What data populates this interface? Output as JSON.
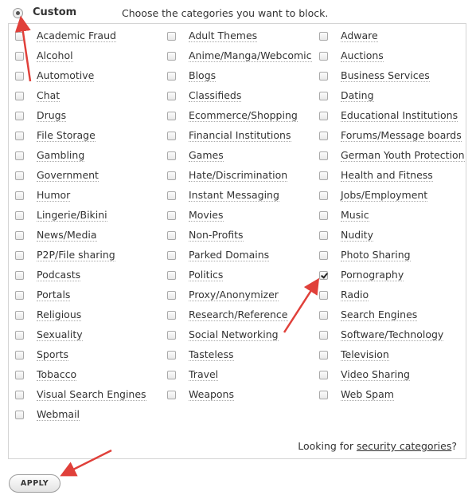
{
  "filter_mode": {
    "label": "Custom",
    "selected": true
  },
  "instructions": "Choose the categories you want to block.",
  "categories": [
    {
      "label": "Academic Fraud",
      "checked": false
    },
    {
      "label": "Alcohol",
      "checked": false
    },
    {
      "label": "Automotive",
      "checked": false
    },
    {
      "label": "Chat",
      "checked": false
    },
    {
      "label": "Drugs",
      "checked": false
    },
    {
      "label": "File Storage",
      "checked": false
    },
    {
      "label": "Gambling",
      "checked": false
    },
    {
      "label": "Government",
      "checked": false
    },
    {
      "label": "Humor",
      "checked": false
    },
    {
      "label": "Lingerie/Bikini",
      "checked": false
    },
    {
      "label": "News/Media",
      "checked": false
    },
    {
      "label": "P2P/File sharing",
      "checked": false
    },
    {
      "label": "Podcasts",
      "checked": false
    },
    {
      "label": "Portals",
      "checked": false
    },
    {
      "label": "Religious",
      "checked": false
    },
    {
      "label": "Sexuality",
      "checked": false
    },
    {
      "label": "Sports",
      "checked": false
    },
    {
      "label": "Tobacco",
      "checked": false
    },
    {
      "label": "Visual Search Engines",
      "checked": false
    },
    {
      "label": "Webmail",
      "checked": false
    },
    {
      "label": "Adult Themes",
      "checked": false
    },
    {
      "label": "Anime/Manga/Webcomic",
      "checked": false
    },
    {
      "label": "Blogs",
      "checked": false
    },
    {
      "label": "Classifieds",
      "checked": false
    },
    {
      "label": "Ecommerce/Shopping",
      "checked": false
    },
    {
      "label": "Financial Institutions",
      "checked": false
    },
    {
      "label": "Games",
      "checked": false
    },
    {
      "label": "Hate/Discrimination",
      "checked": false
    },
    {
      "label": "Instant Messaging",
      "checked": false
    },
    {
      "label": "Movies",
      "checked": false
    },
    {
      "label": "Non-Profits",
      "checked": false
    },
    {
      "label": "Parked Domains",
      "checked": false
    },
    {
      "label": "Politics",
      "checked": false
    },
    {
      "label": "Proxy/Anonymizer",
      "checked": false
    },
    {
      "label": "Research/Reference",
      "checked": false
    },
    {
      "label": "Social Networking",
      "checked": false
    },
    {
      "label": "Tasteless",
      "checked": false
    },
    {
      "label": "Travel",
      "checked": false
    },
    {
      "label": "Weapons",
      "checked": false
    },
    {
      "label": "Adware",
      "checked": false
    },
    {
      "label": "Auctions",
      "checked": false
    },
    {
      "label": "Business Services",
      "checked": false
    },
    {
      "label": "Dating",
      "checked": false
    },
    {
      "label": "Educational Institutions",
      "checked": false
    },
    {
      "label": "Forums/Message boards",
      "checked": false
    },
    {
      "label": "German Youth Protection",
      "checked": false
    },
    {
      "label": "Health and Fitness",
      "checked": false
    },
    {
      "label": "Jobs/Employment",
      "checked": false
    },
    {
      "label": "Music",
      "checked": false
    },
    {
      "label": "Nudity",
      "checked": false
    },
    {
      "label": "Photo Sharing",
      "checked": false
    },
    {
      "label": "Pornography",
      "checked": true
    },
    {
      "label": "Radio",
      "checked": false
    },
    {
      "label": "Search Engines",
      "checked": false
    },
    {
      "label": "Software/Technology",
      "checked": false
    },
    {
      "label": "Television",
      "checked": false
    },
    {
      "label": "Video Sharing",
      "checked": false
    },
    {
      "label": "Web Spam",
      "checked": false
    }
  ],
  "footer": {
    "prefix": "Looking for ",
    "link": "security categories",
    "suffix": "?"
  },
  "apply_button": "APPLY",
  "annotation_color": "#e0403a"
}
